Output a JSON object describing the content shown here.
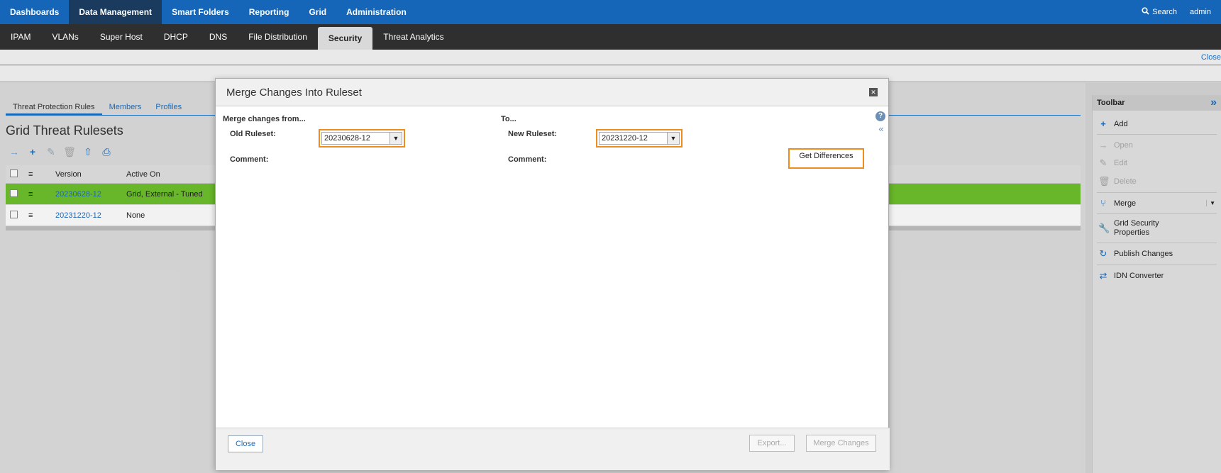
{
  "topnav": {
    "tabs": [
      "Dashboards",
      "Data Management",
      "Smart Folders",
      "Reporting",
      "Grid",
      "Administration"
    ],
    "active": "Data Management",
    "search_label": "Search",
    "user": "admin"
  },
  "subnav": {
    "tabs": [
      "IPAM",
      "VLANs",
      "Super Host",
      "DHCP",
      "DNS",
      "File Distribution",
      "Security",
      "Threat Analytics"
    ],
    "active": "Security"
  },
  "bar1_close": "Close",
  "main": {
    "subtabs": [
      "Threat Protection Rules",
      "Members",
      "Profiles"
    ],
    "title": "Grid Threat Rulesets",
    "columns": [
      "Version",
      "Active On"
    ],
    "rows": [
      {
        "version": "20230628-12",
        "active_on": "Grid, External - Tuned"
      },
      {
        "version": "20231220-12",
        "active_on": "None"
      }
    ]
  },
  "toolbar": {
    "title": "Toolbar",
    "items": {
      "add": "Add",
      "open": "Open",
      "edit": "Edit",
      "delete": "Delete",
      "merge": "Merge",
      "grid_security": "Grid Security Properties",
      "publish": "Publish Changes",
      "idn": "IDN Converter"
    }
  },
  "modal": {
    "title": "Merge Changes Into Ruleset",
    "from_label": "Merge changes from...",
    "to_label": "To...",
    "old_ruleset_label": "Old Ruleset:",
    "old_ruleset_value": "20230628-12",
    "new_ruleset_label": "New Ruleset:",
    "new_ruleset_value": "20231220-12",
    "comment_label": "Comment:",
    "get_differences": "Get Differences",
    "close": "Close",
    "export": "Export...",
    "merge_changes": "Merge Changes"
  }
}
